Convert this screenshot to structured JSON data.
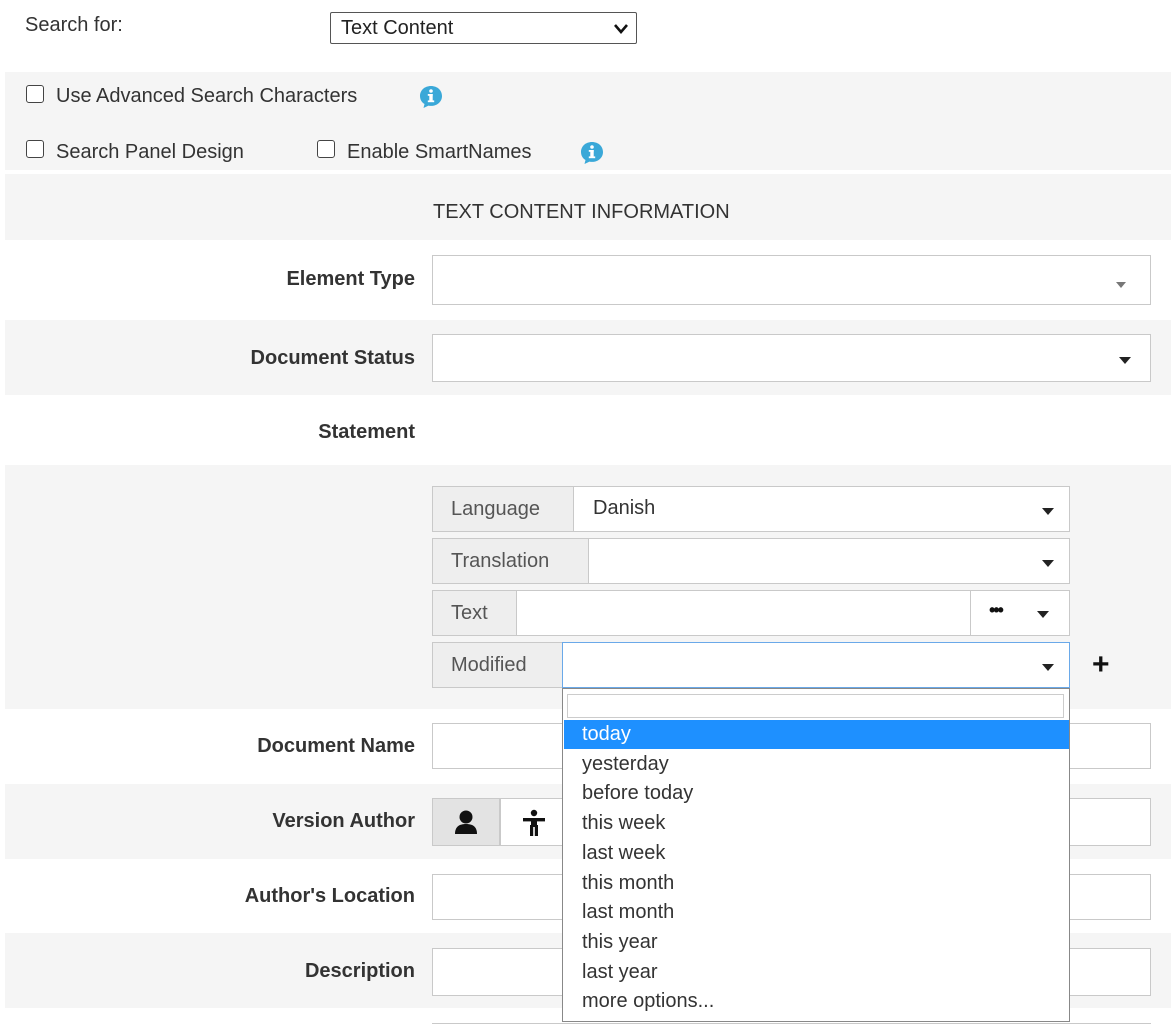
{
  "search_for": {
    "label": "Search for:",
    "selected": "Text Content"
  },
  "options": {
    "advanced_chars": "Use Advanced Search Characters",
    "panel_design": "Search Panel Design",
    "smartnames": "Enable SmartNames"
  },
  "section_title": "TEXT CONTENT INFORMATION",
  "fields": {
    "element_type": "Element Type",
    "document_status": "Document Status",
    "statement": "Statement",
    "document_name": "Document Name",
    "version_author": "Version Author",
    "authors_location": "Author's Location",
    "description": "Description"
  },
  "statement": {
    "language_label": "Language",
    "language_value": "Danish",
    "translation_label": "Translation",
    "text_label": "Text",
    "modified_label": "Modified",
    "more_glyph": "•••",
    "add_glyph": "+"
  },
  "modified_dropdown": {
    "items": [
      "today",
      "yesterday",
      "before today",
      "this week",
      "last week",
      "this month",
      "last month",
      "this year",
      "last year",
      "more options..."
    ],
    "selected_index": 0
  },
  "icons": [
    "info-icon",
    "chevron-down-icon",
    "person-icon",
    "accessibility-icon",
    "ellipsis-icon",
    "plus-icon"
  ],
  "colors": {
    "info_icon": "#3aa8d8",
    "highlight": "#1e90ff",
    "band": "#f5f5f5"
  }
}
